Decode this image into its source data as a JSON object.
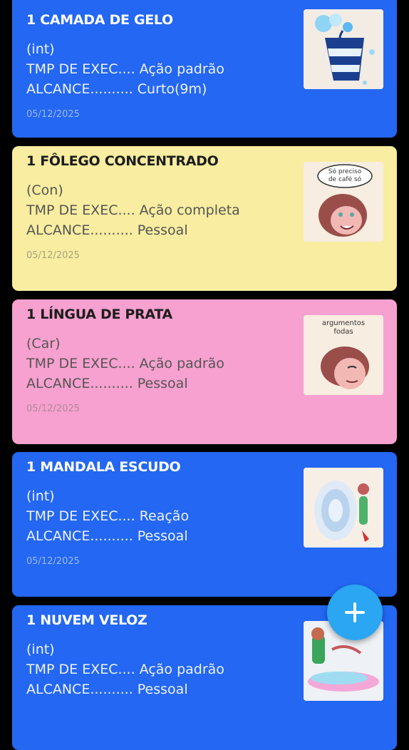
{
  "cards": [
    {
      "title": "1 CAMADA DE GELO",
      "attr": "(int)",
      "exec_label": "TMP DE EXEC....",
      "exec_value": "Ação padrão",
      "range_label": "ALCANCE..........",
      "range_value": "Curto(9m)",
      "date": "05/12/2025",
      "color": "#2367f2"
    },
    {
      "title": "1 FÔLEGO CONCENTRADO",
      "attr": "(Con)",
      "exec_label": "TMP DE EXEC....",
      "exec_value": "Ação completa",
      "range_label": "ALCANCE..........",
      "range_value": "Pessoal",
      "date": "05/12/2025",
      "color": "#f8eda0",
      "image_text": "Só preciso de café só"
    },
    {
      "title": "1 LÍNGUA DE PRATA",
      "attr": "(Car)",
      "exec_label": "TMP DE EXEC....",
      "exec_value": "Ação padrão",
      "range_label": "ALCANCE..........",
      "range_value": "Pessoal",
      "date": "05/12/2025",
      "color": "#f6a1cf",
      "image_text": "argumentos fodas"
    },
    {
      "title": "1 MANDALA ESCUDO",
      "attr": "(int)",
      "exec_label": "TMP DE EXEC....",
      "exec_value": "Reação",
      "range_label": "ALCANCE..........",
      "range_value": "Pessoal",
      "date": "05/12/2025",
      "color": "#2367f2"
    },
    {
      "title": "1 NUVEM VELOZ",
      "attr": "(int)",
      "exec_label": "TMP DE EXEC....",
      "exec_value": "Ação padrão",
      "range_label": "ALCANCE..........",
      "range_value": "Pessoal",
      "color": "#2367f2"
    }
  ],
  "fab": {
    "icon": "plus-icon",
    "color": "#2aa6f2"
  }
}
